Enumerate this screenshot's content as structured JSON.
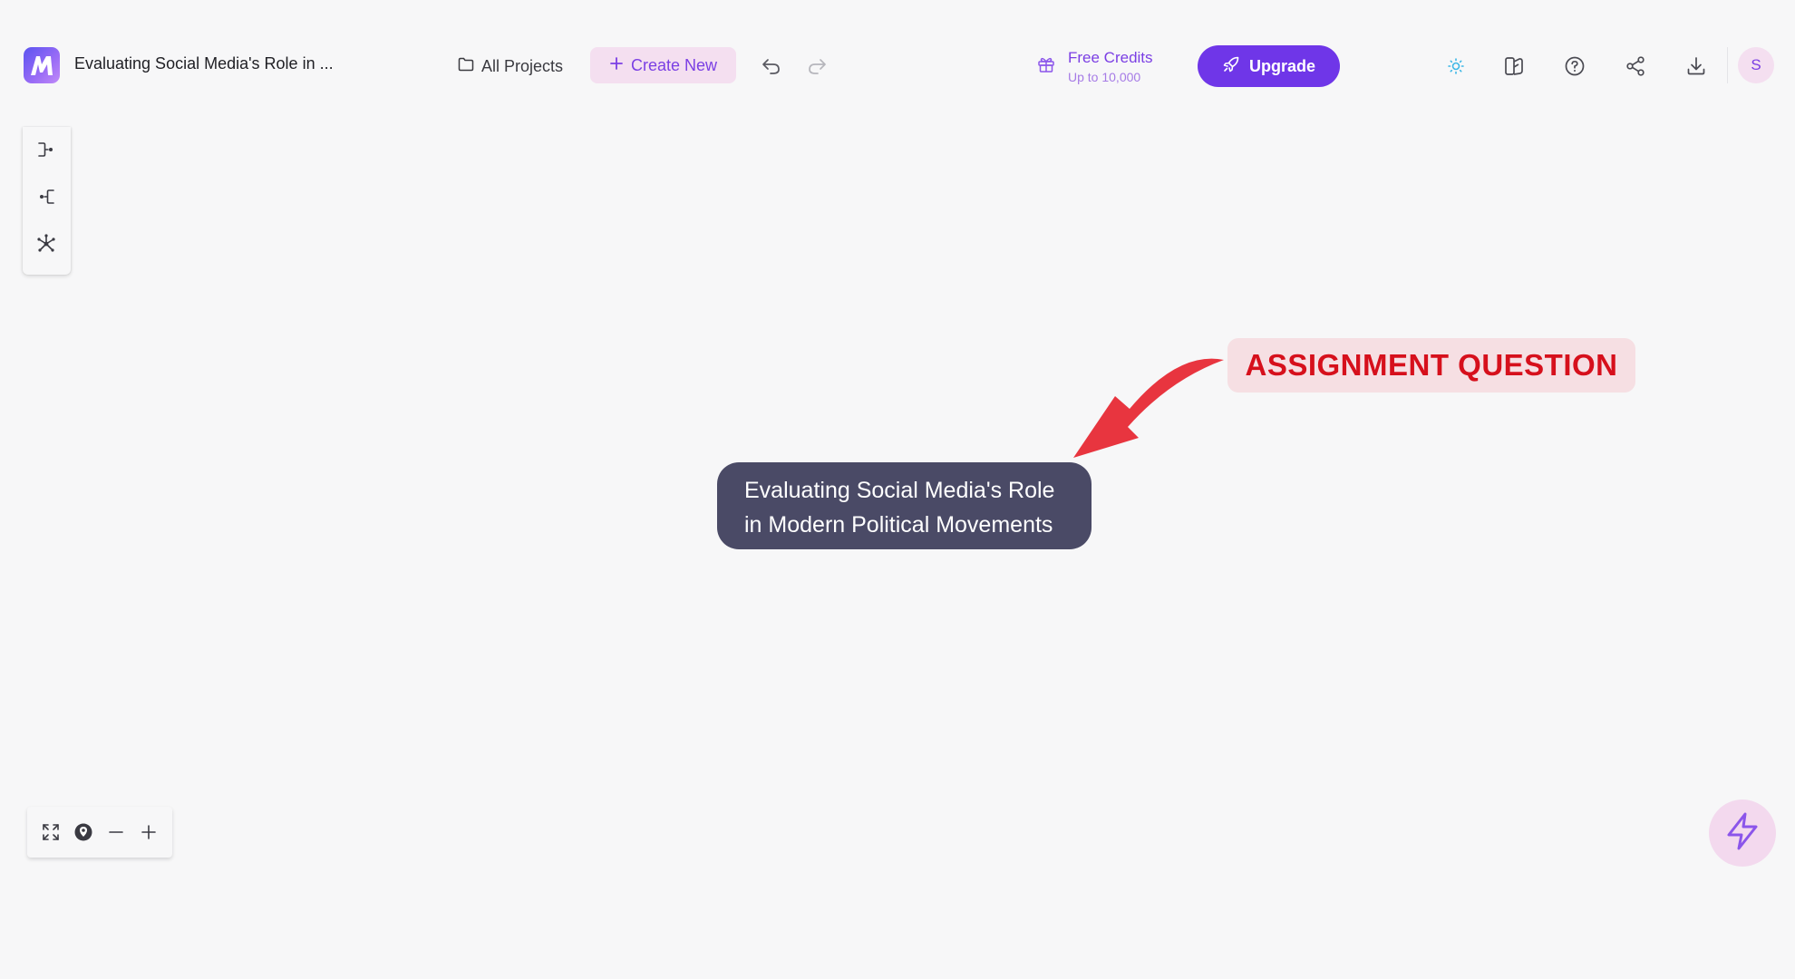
{
  "header": {
    "title": "Evaluating Social Media's Role in ...",
    "all_projects": "All Projects",
    "create_new": "Create New",
    "credits_title": "Free Credits",
    "credits_sub": "Up to 10,000",
    "upgrade": "Upgrade",
    "avatar_initial": "S"
  },
  "canvas": {
    "central_node_line1": "Evaluating Social Media's Role",
    "central_node_line2": "in Modern Political Movements",
    "annotation": "ASSIGNMENT QUESTION"
  },
  "colors": {
    "accent": "#6f36e8",
    "accent_soft": "#f4dff0",
    "node_bg": "#4a4a66",
    "annotation_red": "#d6101c",
    "arrow_red": "#e8353f"
  },
  "icons": [
    "logo-icon",
    "folder-icon",
    "plus-icon",
    "undo-icon",
    "redo-icon",
    "gift-icon",
    "rocket-icon",
    "theme-sun-icon",
    "layout-panel-icon",
    "help-icon",
    "share-icon",
    "download-icon",
    "layout-right-icon",
    "layout-left-icon",
    "layout-radial-icon",
    "fit-screen-icon",
    "locate-icon",
    "zoom-out-icon",
    "zoom-in-icon",
    "lightning-icon"
  ]
}
